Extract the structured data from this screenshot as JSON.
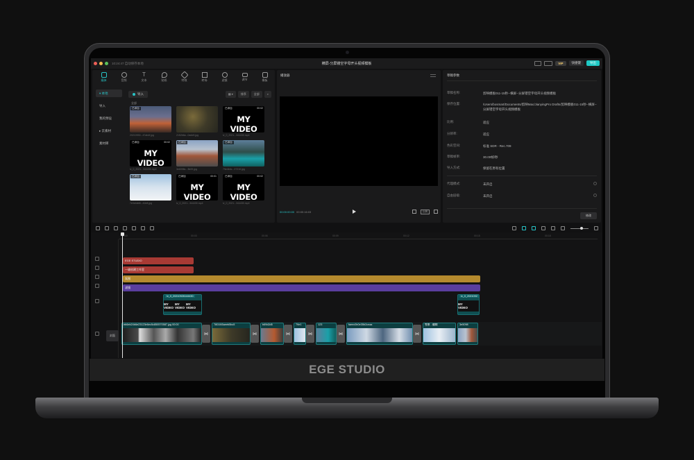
{
  "window": {
    "title": "横屏-分屏镂空字母开头视频模板",
    "menu_text": "10:24:47 自动保存本地"
  },
  "header": {
    "vip_label": "VIP",
    "shortcut_label": "快捷键",
    "export_label": "导出"
  },
  "toolbar": {
    "items": [
      {
        "label": "媒体",
        "icon": "media-icon"
      },
      {
        "label": "音频",
        "icon": "audio-icon"
      },
      {
        "label": "文本",
        "icon": "text-icon"
      },
      {
        "label": "贴纸",
        "icon": "sticker-icon"
      },
      {
        "label": "特效",
        "icon": "effects-icon"
      },
      {
        "label": "转场",
        "icon": "transition-icon"
      },
      {
        "label": "滤镜",
        "icon": "filter-icon"
      },
      {
        "label": "调节",
        "icon": "adjust-icon"
      },
      {
        "label": "模板",
        "icon": "template-icon"
      }
    ]
  },
  "sidebar": {
    "items": [
      {
        "label": "▾ 本地",
        "active": true
      },
      {
        "label": "导入",
        "active": false
      },
      {
        "label": "我的预设",
        "active": false
      },
      {
        "label": "▸ 云素材",
        "active": false
      },
      {
        "label": "素材库",
        "active": false
      }
    ]
  },
  "media": {
    "import_label": "导入",
    "sort_label": "排序",
    "filter_label": "全部",
    "section_label": "全部",
    "items": [
      {
        "badge": "已添加",
        "duration": "",
        "text": "",
        "filename": "20210930...47ab4f.jpg"
      },
      {
        "badge": "",
        "duration": "",
        "text": "",
        "filename": "2152b6a...0a4d9.jpg"
      },
      {
        "badge": "已添加",
        "duration": "00:02",
        "text": "MY VIDEO",
        "filename": "lv_0_2021...344430.mp4"
      },
      {
        "badge": "已添加",
        "duration": "00:02",
        "text": "MY VIDEO",
        "filename": "lv_0_2021...344430.mp4"
      },
      {
        "badge": "已添加",
        "duration": "",
        "text": "",
        "filename": "3e6098c...3b09.jpg"
      },
      {
        "badge": "已添加",
        "duration": "",
        "text": "",
        "filename": "79e4b4c...27210.jpg"
      },
      {
        "badge": "已添加",
        "duration": "",
        "text": "",
        "filename": "7e3d4db8...41b8.jpg"
      },
      {
        "badge": "已添加",
        "duration": "00:01",
        "text": "MY VIDEO",
        "filename": "lv_0_2021...344430.mp4"
      },
      {
        "badge": "已添加",
        "duration": "00:02",
        "text": "MY VIDEO",
        "filename": "lv_0_2021...344430.mp4"
      }
    ]
  },
  "player": {
    "title": "播放器",
    "current_time": "00:00:00:00",
    "total_time": "00:00:16:03",
    "ratio_label": "比例"
  },
  "params": {
    "title": "草稿参数",
    "rows": [
      {
        "key": "草稿名称:",
        "value": "剪映模板011-15秒--横屏--分屏镂空字母开头视频模板"
      },
      {
        "key": "保存位置:",
        "value": "/Users/bosmart/Documents/剪映Mac/JianyingPro Drafts/剪映模板011-15秒--横屏--分屏镂空字母开头视频模板"
      },
      {
        "key": "比例:",
        "value": "适应"
      },
      {
        "key": "分辨率:",
        "value": "适应"
      },
      {
        "key": "色彩空间:",
        "value": "标准 SDR - Rec.709"
      },
      {
        "key": "草稿帧率:",
        "value": "30.00帧/秒"
      },
      {
        "key": "导入方式:",
        "value": "保留在原有位置"
      },
      {
        "key": "代理模式:",
        "value": "未开启"
      },
      {
        "key": "自由层级:",
        "value": "未开启"
      }
    ],
    "modify_label": "修改"
  },
  "timeline": {
    "ticks": [
      "00:00",
      "00:03",
      "00:06",
      "00:09",
      "00:12",
      "00:15",
      "00:18"
    ],
    "text_clips": [
      {
        "label": "EGE STUDIO"
      },
      {
        "label": "一键创建工作室"
      }
    ],
    "effect_clip": "氛围",
    "filter_clip": "滤镜",
    "overlay_clips": [
      {
        "label": "lv_0_20210926144430",
        "frame_text": "MY VIDEO"
      },
      {
        "label": "lv_0_2021092",
        "frame_text": "MY VIDEO"
      }
    ],
    "cover_label": "封面",
    "main_clips": [
      {
        "label": "eb6eb24b6e23123e6ec5c850570587.jpg 00:00"
      },
      {
        "label": "7801f45aeeb5bc5"
      },
      {
        "label": "b69d2d5"
      },
      {
        "label": "79e1"
      },
      {
        "label": "123"
      },
      {
        "label": "faeec0b0e35b2ceaa"
      },
      {
        "label": "雪景 - 编辑"
      },
      {
        "label": "3e5098"
      }
    ]
  },
  "footer": {
    "brand": "EGE STUDIO"
  },
  "colors": {
    "accent": "#28c5c7",
    "text_clip": "#a83a34",
    "effect_clip": "#b58a2e",
    "filter_clip": "#5a3e9e",
    "video_clip": "#0f4f52"
  }
}
